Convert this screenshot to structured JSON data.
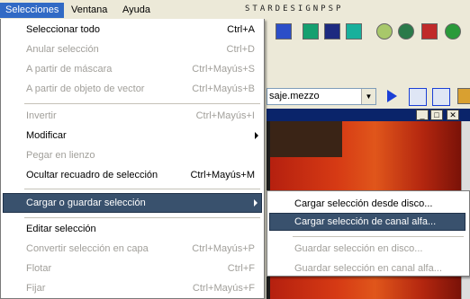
{
  "menubar": {
    "items": [
      "Selecciones",
      "Ventana",
      "Ayuda"
    ],
    "brand": "STARDESIGNPSP"
  },
  "toolbar": {
    "combo_value": "saje.mezzo"
  },
  "menu": {
    "items": [
      {
        "label": "Seleccionar todo",
        "shortcut": "Ctrl+A",
        "enabled": true
      },
      {
        "label": "Anular selección",
        "shortcut": "Ctrl+D",
        "enabled": false
      },
      {
        "label": "A partir de máscara",
        "shortcut": "Ctrl+Mayús+S",
        "enabled": false
      },
      {
        "label": "A partir de objeto de vector",
        "shortcut": "Ctrl+Mayús+B",
        "enabled": false
      },
      {
        "label": "Invertir",
        "shortcut": "Ctrl+Mayús+I",
        "enabled": false
      },
      {
        "label": "Modificar",
        "shortcut": "",
        "enabled": true,
        "submenu": true
      },
      {
        "label": "Pegar en lienzo",
        "shortcut": "",
        "enabled": false
      },
      {
        "label": "Ocultar recuadro de selección",
        "shortcut": "Ctrl+Mayús+M",
        "enabled": true
      },
      {
        "label": "Cargar o guardar selección",
        "shortcut": "",
        "enabled": true,
        "submenu": true,
        "highlighted": true
      },
      {
        "label": "Editar selección",
        "shortcut": "",
        "enabled": true
      },
      {
        "label": "Convertir selección en capa",
        "shortcut": "Ctrl+Mayús+P",
        "enabled": false
      },
      {
        "label": "Flotar",
        "shortcut": "Ctrl+F",
        "enabled": false
      },
      {
        "label": "Fijar",
        "shortcut": "Ctrl+Mayús+F",
        "enabled": false
      }
    ]
  },
  "submenu": {
    "items": [
      {
        "label": "Cargar selección desde disco...",
        "enabled": true
      },
      {
        "label": "Cargar selección de canal alfa...",
        "enabled": true,
        "highlighted": true
      },
      {
        "label": "Guardar selección en disco...",
        "enabled": false
      },
      {
        "label": "Guardar selección en canal alfa...",
        "enabled": false
      }
    ]
  },
  "colors": {
    "menu_highlight": "#39516d",
    "menubar_active": "#316ac5",
    "disabled_text": "#a19f9a"
  }
}
